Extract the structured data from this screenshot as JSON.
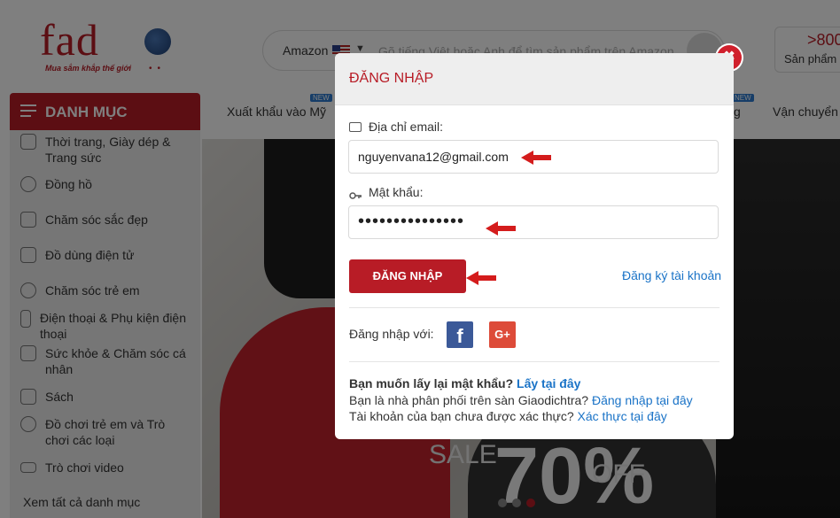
{
  "header": {
    "logo_text": "fad",
    "logo_tagline": "Mua sắm khắp thế giới",
    "search_source": "Amazon",
    "search_placeholder": "Gõ tiếng Việt hoặc Anh để tìm sản phẩm trên Amazon",
    "promo_big": ">800",
    "promo_small": "Sản phẩm"
  },
  "categories": {
    "title": "DANH MỤC",
    "items": [
      {
        "label": "Thời trang, Giày dép & Trang sức",
        "icon": "shirt-icon"
      },
      {
        "label": "Đồng hồ",
        "icon": "watch-icon"
      },
      {
        "label": "Chăm sóc sắc đẹp",
        "icon": "beauty-icon"
      },
      {
        "label": "Đồ dùng điện tử",
        "icon": "camera-icon"
      },
      {
        "label": "Chăm sóc trẻ em",
        "icon": "baby-icon"
      },
      {
        "label": "Điện thoại & Phụ kiện điện thoại",
        "icon": "phone-icon"
      },
      {
        "label": "Sức khỏe & Chăm sóc cá nhân",
        "icon": "heart-icon"
      },
      {
        "label": "Sách",
        "icon": "book-icon"
      },
      {
        "label": "Đồ chơi trẻ em và Trò chơi các loại",
        "icon": "toy-icon"
      },
      {
        "label": "Trò chơi video",
        "icon": "gamepad-icon"
      }
    ],
    "view_all": "Xem tất cả danh mục"
  },
  "nav": {
    "export_label": "Xuất khẩu vào Mỹ",
    "new_badge": "NEW",
    "partial_label": "g",
    "shipping_label": "Vận chuyển"
  },
  "banner": {
    "sale_text": "SALE",
    "percent_text": "70%",
    "off_text": "OFF"
  },
  "modal": {
    "title": "ĐĂNG NHẬP",
    "email_label": "Địa chỉ email:",
    "email_value": "nguyenvana12@gmail.com",
    "password_label": "Mật khẩu:",
    "password_value": "•••••••••••••••",
    "login_button": "ĐĂNG NHẬP",
    "register_link": "Đăng ký tài khoản",
    "social_label": "Đăng nhập với:",
    "facebook": "f",
    "google": "G+",
    "forgot_text": "Bạn muốn lấy lại mật khẩu?",
    "forgot_link": "Lấy tại đây",
    "distributor_text": "Bạn là nhà phân phối trên sàn Giaodichtra?",
    "distributor_link": "Đăng nhập tại đây",
    "unverified_text": "Tài khoản của bạn chưa được xác thực?",
    "unverified_link": "Xác thực tại đây",
    "close": "✖"
  },
  "colors": {
    "brand": "#b81c26",
    "link": "#1a73c7",
    "facebook": "#3b5998",
    "google": "#dd4b39"
  }
}
